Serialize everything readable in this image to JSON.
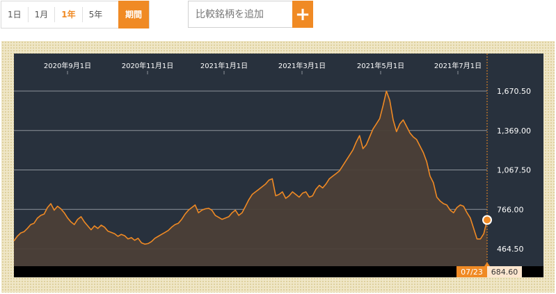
{
  "range_selector": {
    "buttons": [
      "1日",
      "1月",
      "1年",
      "5年"
    ],
    "active_index": 2,
    "period_label": "期間"
  },
  "compare": {
    "placeholder": "比較銘柄を追加",
    "add_icon": "plus-icon"
  },
  "colors": {
    "accent": "#f08a24",
    "plot_bg": "#28313d",
    "grid": "#8e949b",
    "area_fill": "#4b3f37"
  },
  "chart_data": {
    "type": "area",
    "x_ticks": [
      "2020年9月1日",
      "2020年11月1日",
      "2021年1月1日",
      "2021年3月1日",
      "2021年5月1日",
      "2021年7月1日"
    ],
    "y_ticks": [
      "1,670.50",
      "1,369.00",
      "1,067.50",
      "766.00",
      "464.50"
    ],
    "ylim": [
      464.5,
      1670.5
    ],
    "grid": true,
    "y_axis_side": "right",
    "series": [
      {
        "values": [
          525,
          560,
          585,
          595,
          620,
          650,
          660,
          700,
          720,
          730,
          780,
          810,
          760,
          790,
          770,
          740,
          700,
          670,
          650,
          690,
          710,
          670,
          640,
          610,
          640,
          620,
          645,
          630,
          600,
          590,
          580,
          560,
          575,
          565,
          540,
          550,
          530,
          545,
          510,
          500,
          505,
          520,
          545,
          560,
          575,
          590,
          605,
          630,
          650,
          660,
          690,
          730,
          760,
          780,
          800,
          740,
          760,
          770,
          775,
          760,
          720,
          705,
          690,
          700,
          710,
          740,
          760,
          720,
          740,
          790,
          840,
          880,
          900,
          920,
          940,
          960,
          990,
          1000,
          870,
          880,
          900,
          850,
          870,
          900,
          880,
          860,
          890,
          900,
          860,
          870,
          920,
          950,
          930,
          960,
          1000,
          1020,
          1040,
          1060,
          1100,
          1140,
          1180,
          1220,
          1280,
          1330,
          1230,
          1260,
          1320,
          1380,
          1420,
          1460,
          1560,
          1670,
          1600,
          1450,
          1360,
          1420,
          1450,
          1400,
          1350,
          1320,
          1300,
          1250,
          1200,
          1130,
          1020,
          970,
          860,
          830,
          810,
          800,
          760,
          740,
          780,
          800,
          790,
          740,
          700,
          620,
          540,
          540,
          580,
          685
        ]
      }
    ],
    "last_point": {
      "date": "07/23",
      "value": "684.60"
    }
  }
}
